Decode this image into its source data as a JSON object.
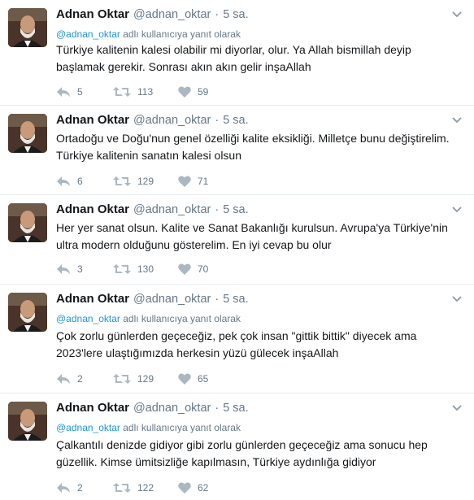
{
  "colors": {
    "meta": "#657786",
    "mention": "#1b95e0",
    "icon": "#aab8c2",
    "border": "#e6ecf0"
  },
  "tweets": [
    {
      "name": "Adnan Oktar",
      "handle": "@adnan_oktar",
      "dot": "·",
      "time": "5 sa.",
      "reply_mention": "@adnan_oktar",
      "reply_suffix": " adlı kullanıcıya yanıt olarak",
      "text": "Türkiye kalitenin kalesi olabilir mi diyorlar, olur. Ya Allah bismillah deyip başlamak gerekir. Sonrası akın akın gelir inşaAllah",
      "replies": "5",
      "retweets": "113",
      "likes": "59"
    },
    {
      "name": "Adnan Oktar",
      "handle": "@adnan_oktar",
      "dot": "·",
      "time": "5 sa.",
      "text": "Ortadoğu ve Doğu'nun genel özelliği kalite eksikliği. Milletçe bunu değiştirelim. Türkiye kalitenin sanatın kalesi olsun",
      "replies": "6",
      "retweets": "129",
      "likes": "71"
    },
    {
      "name": "Adnan Oktar",
      "handle": "@adnan_oktar",
      "dot": "·",
      "time": "5 sa.",
      "text": "Her yer sanat olsun. Kalite ve Sanat Bakanlığı kurulsun. Avrupa'ya Türkiye'nin ultra modern olduğunu gösterelim. En iyi cevap bu olur",
      "replies": "3",
      "retweets": "130",
      "likes": "70"
    },
    {
      "name": "Adnan Oktar",
      "handle": "@adnan_oktar",
      "dot": "·",
      "time": "5 sa.",
      "reply_mention": "@adnan_oktar",
      "reply_suffix": " adlı kullanıcıya yanıt olarak",
      "text": "Çok zorlu günlerden geçeceğiz, pek çok insan \"gittik bittik\" diyecek ama 2023'lere ulaştığımızda herkesin yüzü gülecek inşaAllah",
      "replies": "2",
      "retweets": "129",
      "likes": "65"
    },
    {
      "name": "Adnan Oktar",
      "handle": "@adnan_oktar",
      "dot": "·",
      "time": "5 sa.",
      "reply_mention": "@adnan_oktar",
      "reply_suffix": " adlı kullanıcıya yanıt olarak",
      "text": "Çalkantılı denizde gidiyor gibi zorlu günlerden geçeceğiz ama sonucu hep güzellik. Kimse ümitsizliğe kapılmasın, Türkiye aydınlığa gidiyor",
      "replies": "2",
      "retweets": "122",
      "likes": "62"
    }
  ]
}
